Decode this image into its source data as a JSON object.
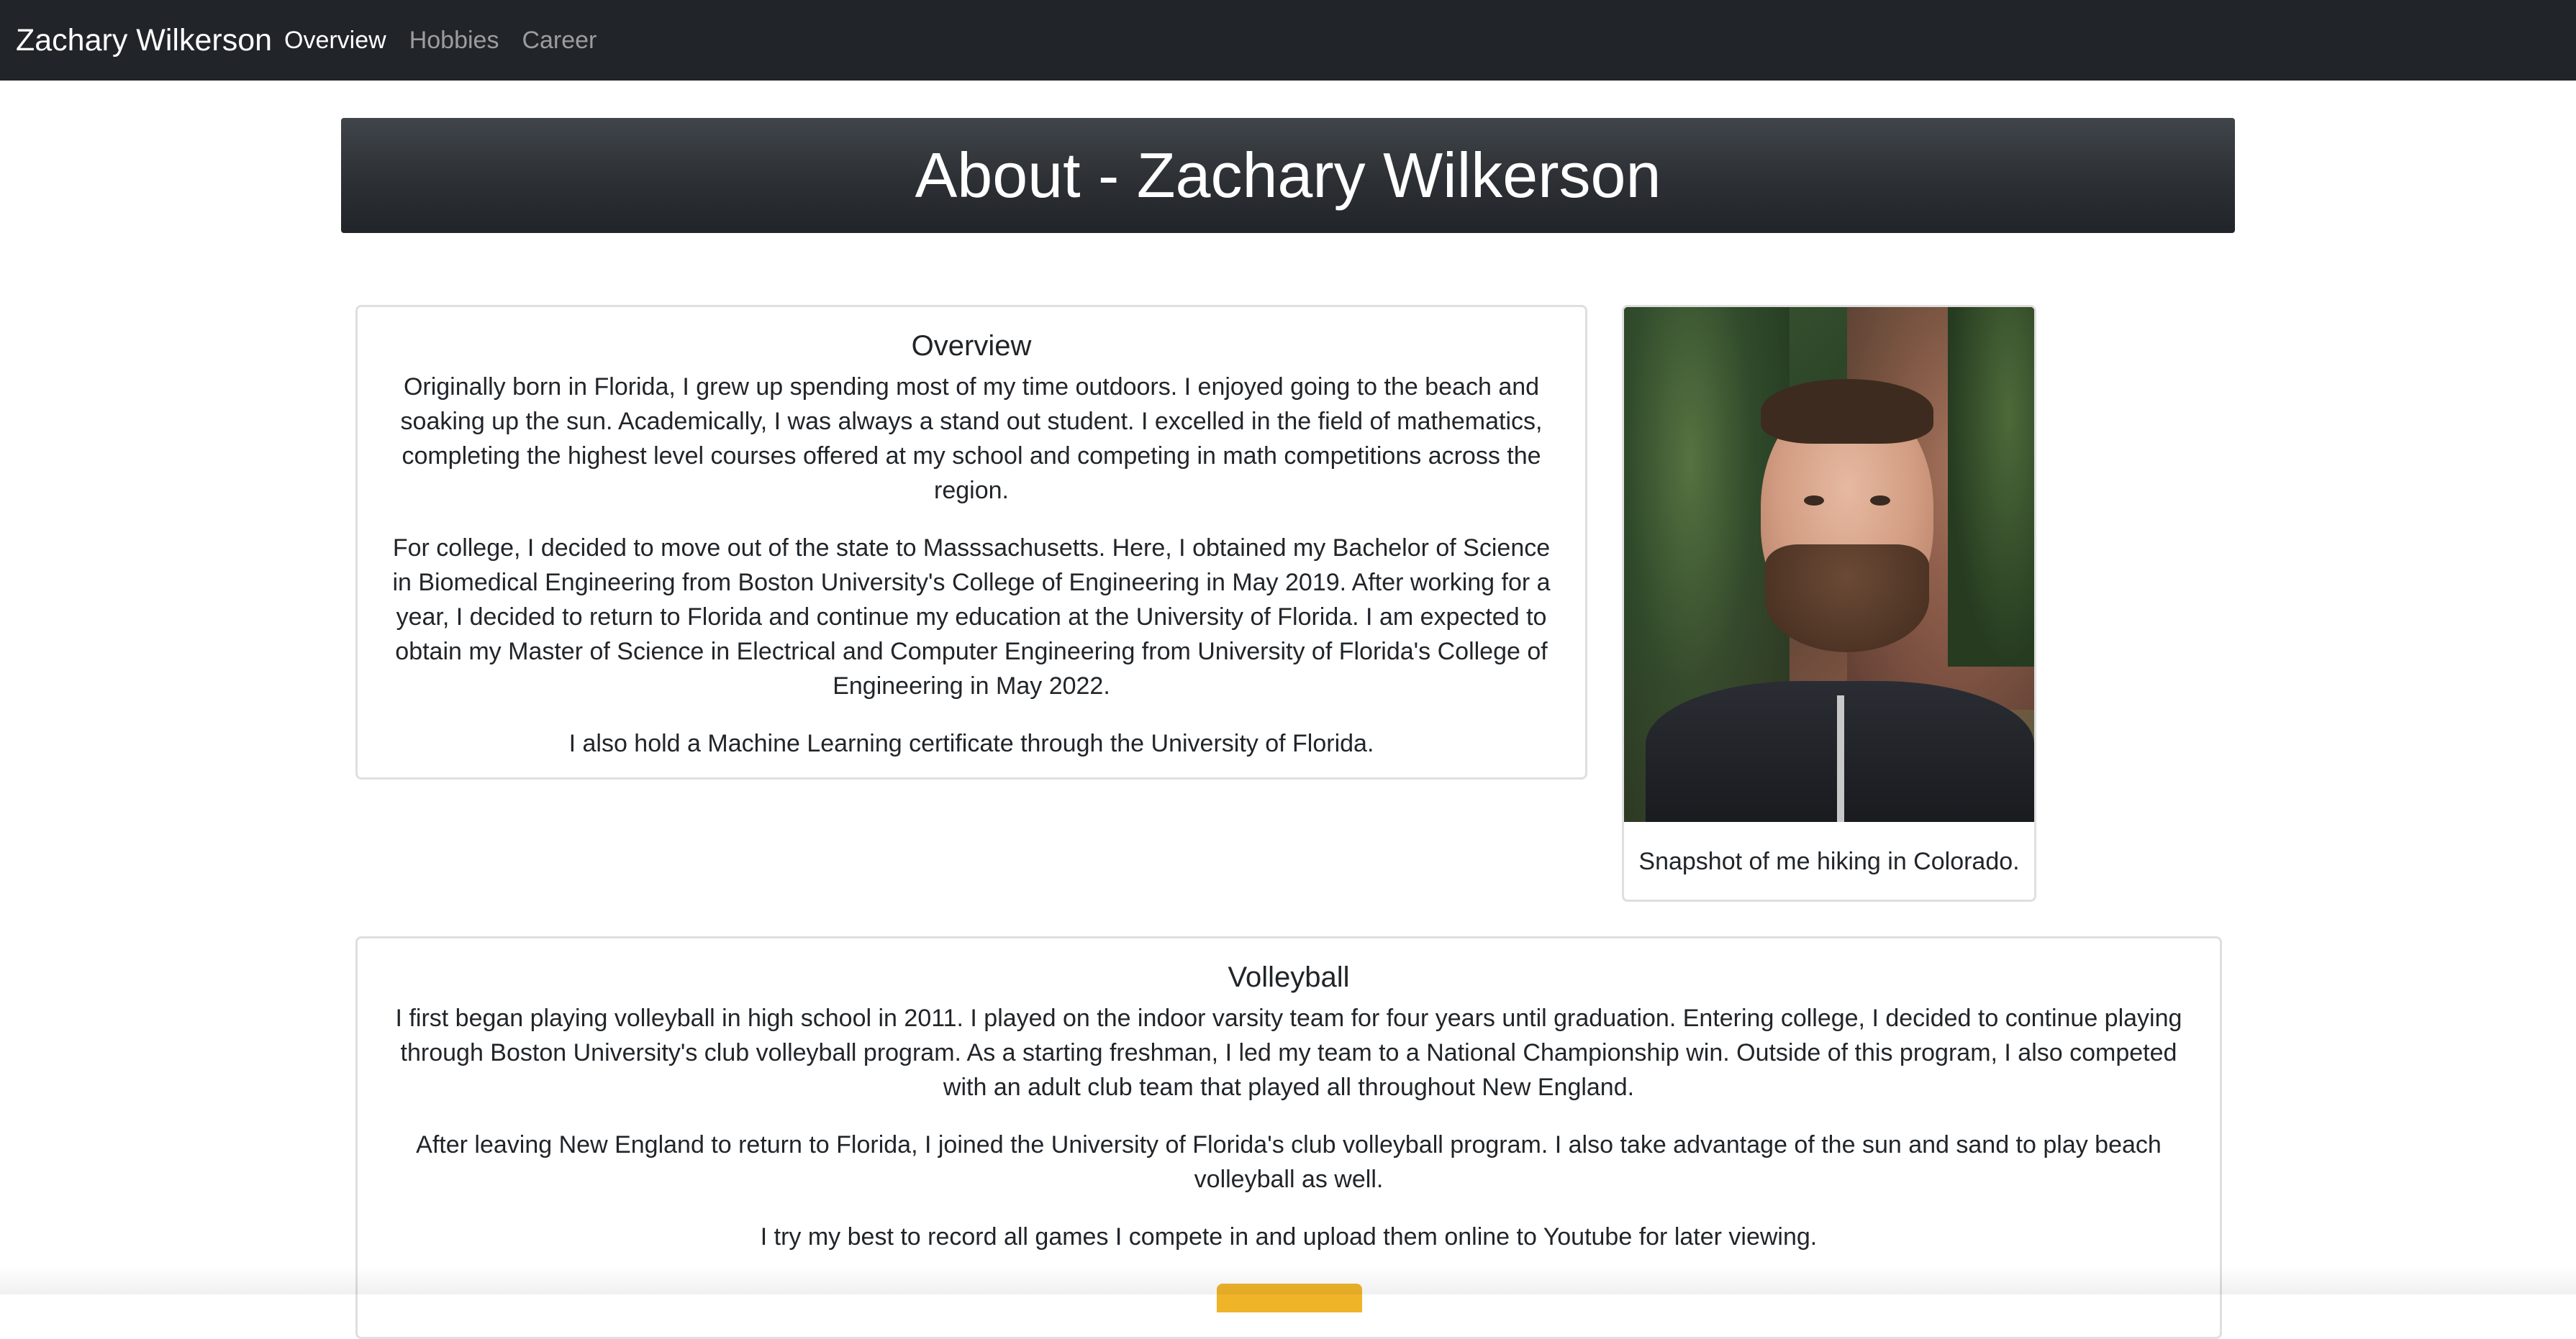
{
  "navbar": {
    "brand": "Zachary Wilkerson",
    "links": [
      {
        "label": "Overview",
        "active": true
      },
      {
        "label": "Hobbies",
        "active": false
      },
      {
        "label": "Career",
        "active": false
      }
    ]
  },
  "hero": {
    "title": "About - Zachary Wilkerson"
  },
  "overview": {
    "heading": "Overview",
    "paragraphs": [
      "Originally born in Florida, I grew up spending most of my time outdoors. I enjoyed going to the beach and soaking up the sun. Academically, I was always a stand out student. I excelled in the field of mathematics, completing the highest level courses offered at my school and competing in math competitions across the region.",
      "For college, I decided to move out of the state to Masssachusetts. Here, I obtained my Bachelor of Science in Biomedical Engineering from Boston University's College of Engineering in May 2019. After working for a year, I decided to return to Florida and continue my education at the University of Florida. I am expected to obtain my Master of Science in Electrical and Computer Engineering from University of Florida's College of Engineering in May 2022.",
      "I also hold a Machine Learning certificate through the University of Florida."
    ]
  },
  "photo": {
    "caption": "Snapshot of me hiking in Colorado."
  },
  "volleyball": {
    "heading": "Volleyball",
    "paragraphs": [
      "I first began playing volleyball in high school in 2011. I played on the indoor varsity team for four years until graduation. Entering college, I decided to continue playing through Boston University's club volleyball program. As a starting freshman, I led my team to a National Championship win. Outside of this program, I also competed with an adult club team that played all throughout New England.",
      "After leaving New England to return to Florida, I joined the University of Florida's club volleyball program. I also take advantage of the sun and sand to play beach volleyball as well.",
      "I try my best to record all games I compete in and upload them online to Youtube for later viewing."
    ]
  },
  "colors": {
    "navbar_bg": "#212529",
    "accent_button": "#f0b429"
  }
}
